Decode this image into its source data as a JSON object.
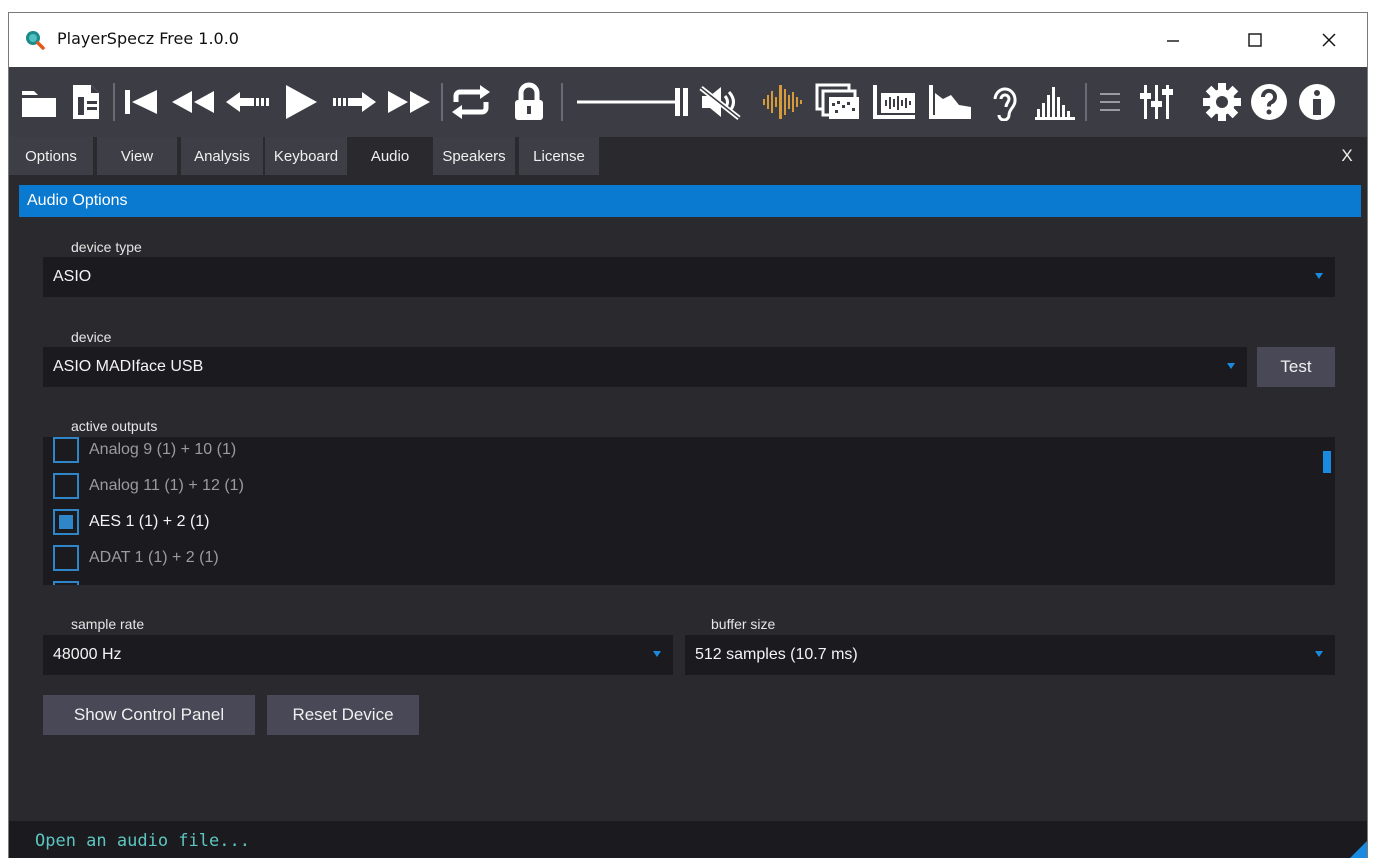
{
  "window": {
    "title": "PlayerSpecz Free 1.0.0",
    "controls": {
      "minimize": "minimize-icon",
      "maximize": "maximize-icon",
      "close": "close-icon"
    }
  },
  "toolbar": {
    "icons": [
      "open-folder-icon",
      "open-file-icon",
      "skip-to-start-icon",
      "rewind-icon",
      "step-back-icon",
      "play-icon",
      "step-forward-icon",
      "fast-forward-icon",
      "loop-icon",
      "lock-icon",
      "volume-slider",
      "mute-icon",
      "waveform-icon",
      "spectrogram-icon",
      "waveform-view-icon",
      "spectrum-icon",
      "ear-icon",
      "histogram-icon",
      "menu-icon",
      "mixer-icon",
      "settings-icon",
      "help-icon",
      "info-icon"
    ],
    "volume_level": 1.0
  },
  "tabs": [
    {
      "label": "Options"
    },
    {
      "label": "View"
    },
    {
      "label": "Analysis"
    },
    {
      "label": "Keyboard"
    },
    {
      "label": "Audio"
    },
    {
      "label": "Speakers"
    },
    {
      "label": "License"
    }
  ],
  "active_tab": "Audio",
  "tab_close_label": "X",
  "audio_options": {
    "header": "Audio Options",
    "device_type": {
      "label": "device type",
      "value": "ASIO"
    },
    "device": {
      "label": "device",
      "value": "ASIO MADIface USB",
      "test_button": "Test"
    },
    "active_outputs": {
      "label": "active outputs",
      "items": [
        {
          "label": "Analog 9 (1) + 10 (1)",
          "checked": false
        },
        {
          "label": "Analog 11 (1) + 12 (1)",
          "checked": false
        },
        {
          "label": "AES 1 (1) + 2 (1)",
          "checked": true
        },
        {
          "label": "ADAT 1 (1) + 2 (1)",
          "checked": false
        }
      ]
    },
    "sample_rate": {
      "label": "sample rate",
      "value": "48000 Hz"
    },
    "buffer_size": {
      "label": "buffer size",
      "value": "512 samples (10.7 ms)"
    },
    "buttons": {
      "show_control_panel": "Show Control Panel",
      "reset_device": "Reset Device"
    }
  },
  "status": {
    "text": "Open an audio file..."
  },
  "colors": {
    "accent": "#0a79d0",
    "toolbar_bg": "#3c3c44",
    "panel_bg": "#2a2a2e",
    "field_bg": "#1b1b1f",
    "orange_icons": "#d79a3a",
    "status_text": "#5dc6c0"
  }
}
